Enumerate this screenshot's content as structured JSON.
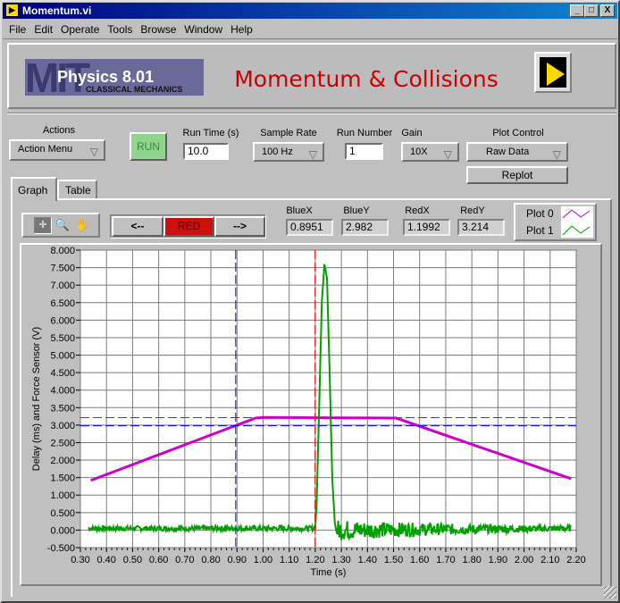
{
  "window": {
    "title": "Momentum.vi",
    "minimize": "_",
    "maximize": "□",
    "close": "X"
  },
  "menu": [
    "File",
    "Edit",
    "Operate",
    "Tools",
    "Browse",
    "Window",
    "Help"
  ],
  "header": {
    "logo_mit": "MIT",
    "logo_course": "Physics 8.01",
    "logo_sub": "CLASSICAL MECHANICS",
    "title": "Momentum & Collisions",
    "title_color": "#cc0000",
    "icon": "labview-vi-icon"
  },
  "controls": {
    "actions_label": "Actions",
    "actions_value": "Action Menu",
    "run_label": "RUN",
    "run_time_label": "Run Time (s)",
    "run_time_value": "10.0",
    "sample_rate_label": "Sample Rate",
    "sample_rate_value": "100 Hz",
    "run_number_label": "Run Number",
    "run_number_value": "1",
    "gain_label": "Gain",
    "gain_value": "10X",
    "plot_control_label": "Plot Control",
    "plot_control_value": "Raw Data",
    "replot_label": "Replot"
  },
  "tabs": [
    {
      "label": "Graph",
      "selected": true
    },
    {
      "label": "Table",
      "selected": false
    }
  ],
  "graph_toolbar": {
    "tools": [
      "cursor-tool-icon",
      "zoom-tool-icon",
      "pan-hand-icon"
    ],
    "prev_label": "<--",
    "cursor_label": "RED",
    "next_label": "-->",
    "cursor_color": "#cc1010"
  },
  "cursors": {
    "bluex_label": "BlueX",
    "bluex": "0.8951",
    "bluey_label": "BlueY",
    "bluey": "2.982",
    "redx_label": "RedX",
    "redx": "1.1992",
    "redy_label": "RedY",
    "redy": "3.214"
  },
  "legend": [
    {
      "name": "Plot 0",
      "color": "#cc00cc"
    },
    {
      "name": "Plot 1",
      "color": "#00a000"
    }
  ],
  "chart_data": {
    "type": "line",
    "xlabel": "Time (s)",
    "ylabel": "Delay (ms) and Force Sensor (V)",
    "xlim": [
      0.3,
      2.2
    ],
    "ylim": [
      -0.5,
      8.0
    ],
    "grid": true,
    "x_ticks": [
      "0.30",
      "0.40",
      "0.50",
      "0.60",
      "0.70",
      "0.80",
      "0.90",
      "1.00",
      "1.10",
      "1.20",
      "1.30",
      "1.40",
      "1.50",
      "1.60",
      "1.70",
      "1.80",
      "1.90",
      "2.00",
      "2.10",
      "2.20"
    ],
    "y_ticks": [
      "-0.500",
      "0.000",
      "0.500",
      "1.000",
      "1.500",
      "2.000",
      "2.500",
      "3.000",
      "3.500",
      "4.000",
      "4.500",
      "5.000",
      "5.500",
      "6.000",
      "6.500",
      "7.000",
      "7.500",
      "8.000"
    ],
    "series": [
      {
        "name": "Plot 0",
        "color": "#cc00cc",
        "x": [
          0.34,
          0.97,
          1.0,
          1.51,
          2.18
        ],
        "y": [
          1.42,
          3.2,
          3.22,
          3.2,
          1.47
        ]
      },
      {
        "name": "Plot 1",
        "color": "#00a000",
        "x": [
          0.33,
          1.2,
          1.205,
          1.215,
          1.225,
          1.235,
          1.245,
          1.255,
          1.265,
          1.275,
          1.28,
          2.18
        ],
        "y": [
          0.05,
          0.05,
          0.7,
          3.5,
          6.5,
          7.6,
          7.2,
          4.5,
          1.5,
          0.2,
          0.0,
          0.05
        ],
        "noise_before": 0.07,
        "noise_after": 0.3
      }
    ],
    "cursors": [
      {
        "name": "blue",
        "color": "#0000ff",
        "x": 0.8951,
        "y": 2.982
      },
      {
        "name": "red",
        "color": "#ff0000",
        "x": 1.1992,
        "y": 3.214
      }
    ]
  }
}
